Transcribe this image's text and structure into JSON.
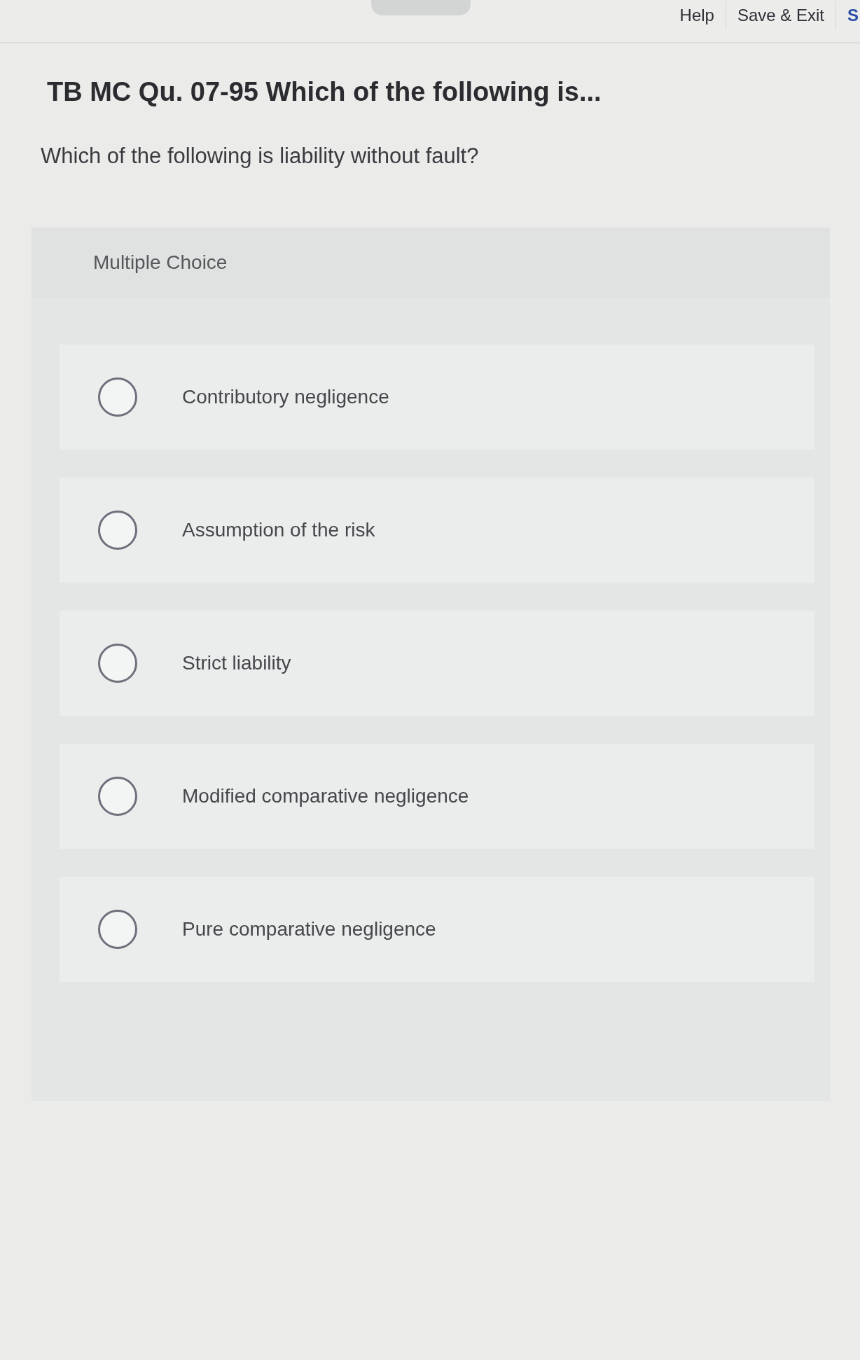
{
  "top_nav": {
    "links": [
      "Help",
      "Save & Exit",
      "S"
    ]
  },
  "question": {
    "title": "TB MC Qu. 07-95 Which of the following is...",
    "text": "Which of the following is liability without fault?"
  },
  "answer_panel": {
    "type_label": "Multiple Choice",
    "choices": [
      {
        "label": "Contributory negligence",
        "selected": false
      },
      {
        "label": "Assumption of the risk",
        "selected": false
      },
      {
        "label": "Strict liability",
        "selected": false
      },
      {
        "label": "Modified comparative negligence",
        "selected": false
      },
      {
        "label": "Pure comparative negligence",
        "selected": false
      }
    ]
  }
}
